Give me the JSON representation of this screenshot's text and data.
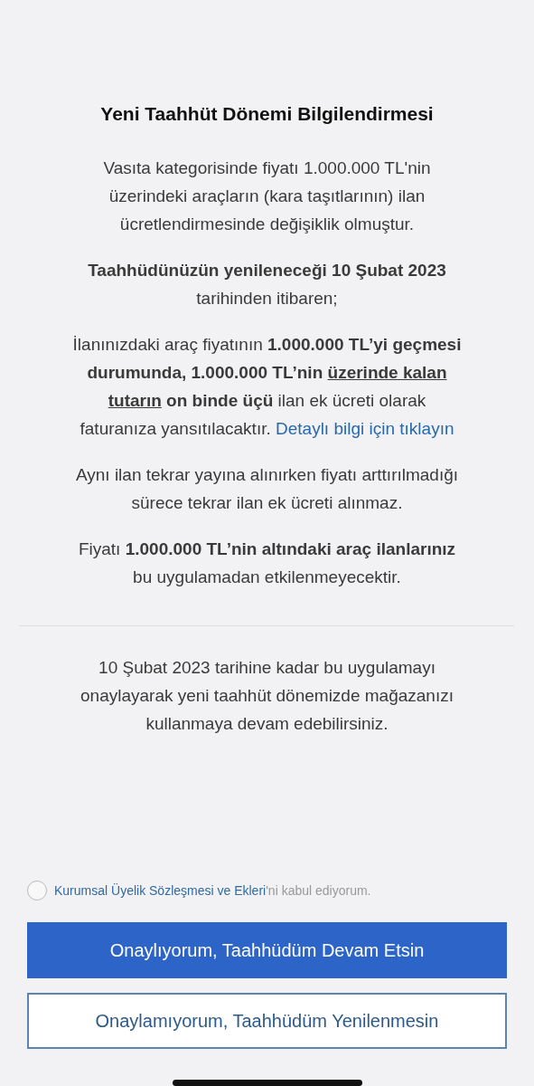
{
  "title": "Yeni Taahhüt Dönemi Bilgilendirmesi",
  "paragraphs": [
    {
      "lines": [
        [
          {
            "kind": "plain",
            "text": "Vasıta kategorisinde fiyatı 1.000.000 TL'nin"
          }
        ],
        [
          {
            "kind": "plain",
            "text": "üzerindeki araçların (kara taşıtlarının) ilan"
          }
        ],
        [
          {
            "kind": "plain",
            "text": "ücretlendirmesinde değişiklik olmuştur."
          }
        ]
      ]
    },
    {
      "lines": [
        [
          {
            "kind": "plain",
            "text": "**Taahhüdünüzün yenileneceği 10 Şubat 2023**"
          }
        ],
        [
          {
            "kind": "plain",
            "text": "tarihinden itibaren;"
          }
        ]
      ]
    },
    {
      "lines": [
        [
          {
            "kind": "plain",
            "text": "İlanınızdaki araç fiyatının **1.000.000 TL’yi geçmesi**"
          }
        ],
        [
          {
            "kind": "plain",
            "text": "**durumunda, 1.000.000 TL’nin** "
          },
          {
            "kind": "underlined",
            "text": "**üzerinde kalan**"
          }
        ],
        [
          {
            "kind": "underlined",
            "text": "**tutarın**"
          },
          {
            "kind": "plain",
            "text": " **on binde üçü** ilan ek ücreti olarak"
          }
        ],
        [
          {
            "kind": "plain",
            "text": "faturanıza yansıtılacaktır. "
          },
          {
            "kind": "link",
            "text": "Detaylı bilgi için tıklayın"
          }
        ]
      ]
    },
    {
      "lines": [
        [
          {
            "kind": "plain",
            "text": "Aynı ilan tekrar yayına alınırken fiyatı arttırılmadığı"
          }
        ],
        [
          {
            "kind": "plain",
            "text": "sürece tekrar ilan ek ücreti alınmaz."
          }
        ]
      ]
    },
    {
      "lines": [
        [
          {
            "kind": "plain",
            "text": "Fiyatı **1.000.000 TL’nin altındaki araç ilanlarınız**"
          }
        ],
        [
          {
            "kind": "plain",
            "text": "bu uygulamadan etkilenmeyecektir."
          }
        ]
      ]
    }
  ],
  "footnote": {
    "lines": [
      [
        {
          "kind": "plain",
          "text": "10 Şubat 2023 tarihine kadar bu uygulamayı"
        }
      ],
      [
        {
          "kind": "plain",
          "text": "onaylayarak yeni taahhüt dönemizde mağazanızı"
        }
      ],
      [
        {
          "kind": "plain",
          "text": "kullanmaya devam edebilirsiniz."
        }
      ]
    ]
  },
  "agreement": {
    "checked": false,
    "link": "Kurumsal Üyelik Sözleşmesi ve Ekleri",
    "suffix": "'ni kabul ediyorum."
  },
  "buttons": [
    {
      "label": "Onaylıyorum, Taahhüdüm Devam Etsin",
      "kind": "primary"
    },
    {
      "label": "Onaylamıyorum, Taahhüdüm Yenilenmesin",
      "kind": "outline"
    }
  ]
}
